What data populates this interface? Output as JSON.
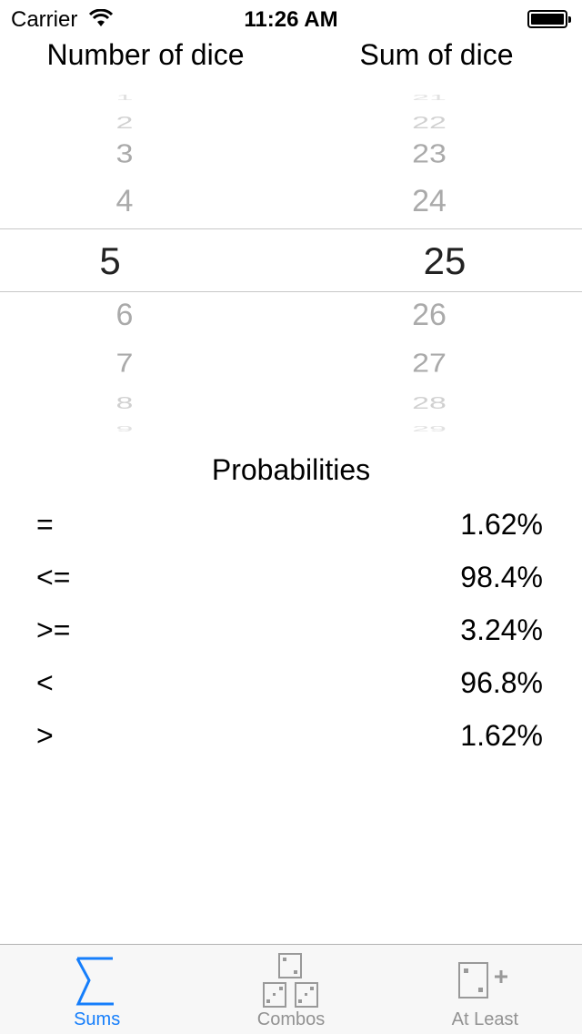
{
  "status": {
    "carrier": "Carrier",
    "time": "11:26 AM"
  },
  "picker": {
    "left_header": "Number of dice",
    "right_header": "Sum of dice",
    "left_values": [
      "1",
      "2",
      "3",
      "4",
      "5",
      "6",
      "7",
      "8",
      "9"
    ],
    "right_values": [
      "21",
      "22",
      "23",
      "24",
      "25",
      "26",
      "27",
      "28",
      "29"
    ],
    "selected_left": "5",
    "selected_right": "25"
  },
  "probabilities": {
    "title": "Probabilities",
    "rows": [
      {
        "op": "=",
        "value": "1.62%"
      },
      {
        "op": "<=",
        "value": "98.4%"
      },
      {
        "op": ">=",
        "value": "3.24%"
      },
      {
        "op": "<",
        "value": "96.8%"
      },
      {
        "op": ">",
        "value": "1.62%"
      }
    ]
  },
  "tabs": [
    {
      "label": "Sums",
      "icon": "sigma-icon",
      "active": true
    },
    {
      "label": "Combos",
      "icon": "three-dice-icon"
    },
    {
      "label": "At Least",
      "icon": "die-plus-icon"
    }
  ],
  "colors": {
    "accent": "#157efb",
    "inactive": "#929292"
  }
}
